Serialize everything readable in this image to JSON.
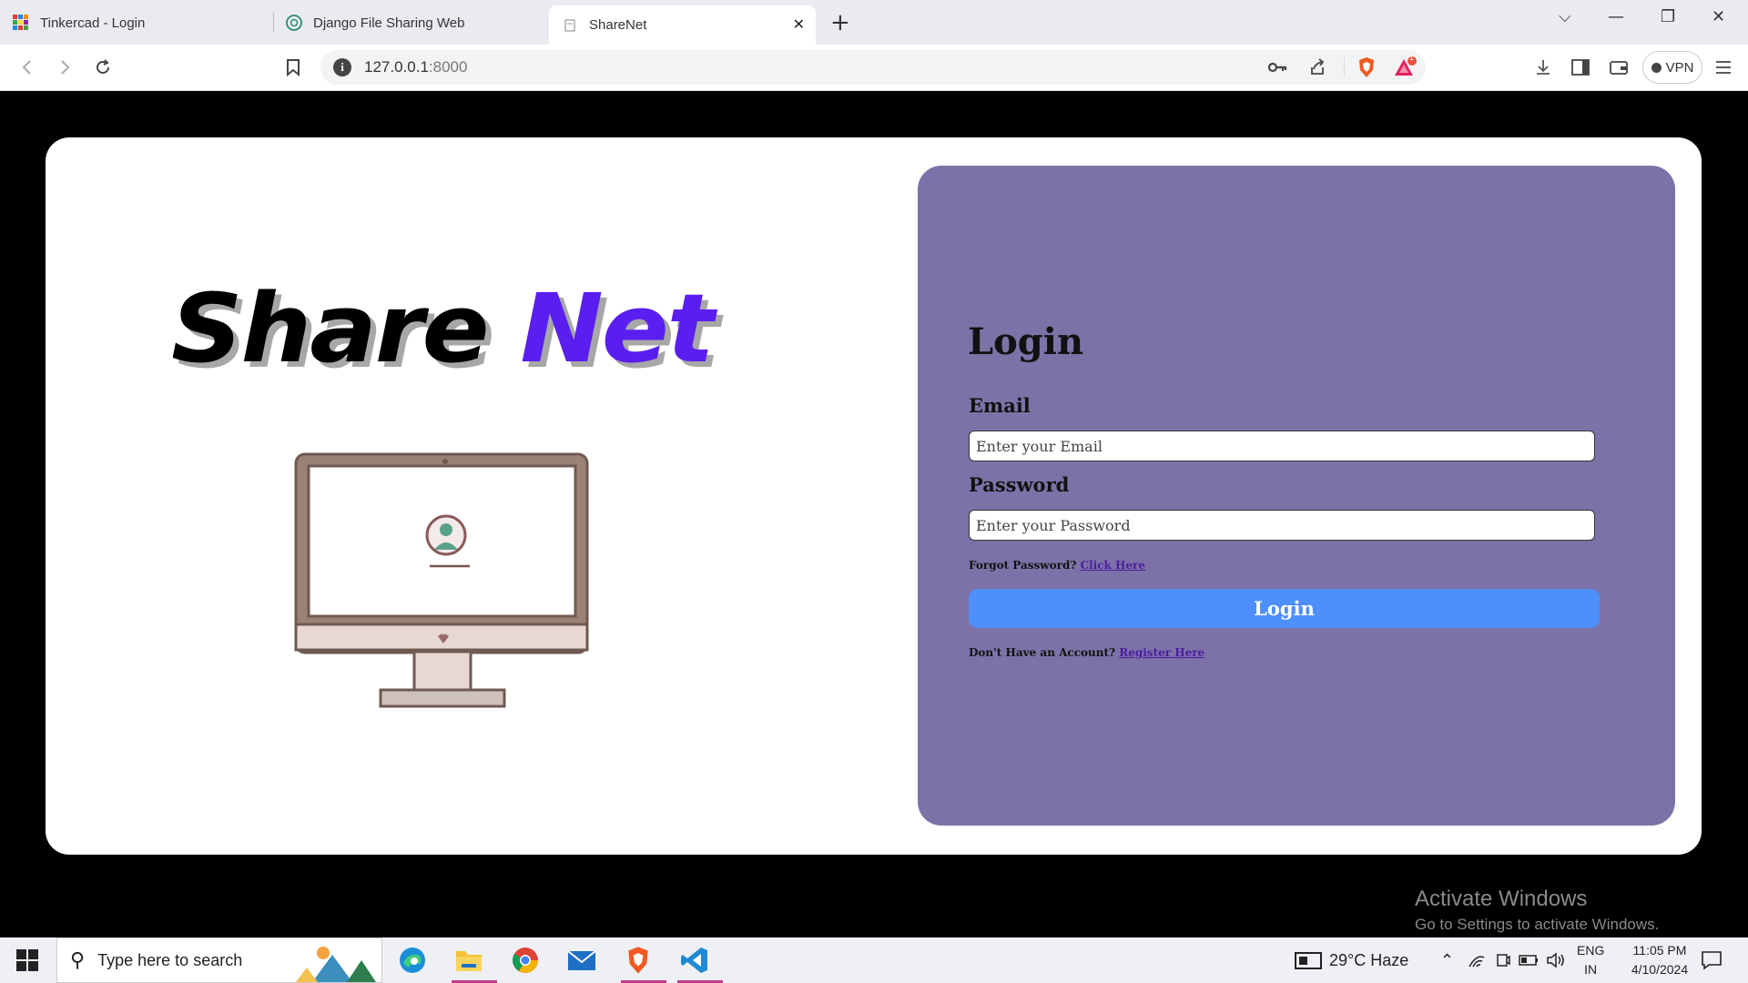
{
  "browser": {
    "tabs": [
      {
        "title": "Tinkercad - Login",
        "active": false
      },
      {
        "title": "Django File Sharing Web",
        "active": false
      },
      {
        "title": "ShareNet",
        "active": true
      }
    ],
    "url_host": "127.0.0.1",
    "url_port": ":8000",
    "vpn_label": "VPN",
    "notification_count": "1"
  },
  "page": {
    "logo_share": "Share",
    "logo_net": "Net",
    "login": {
      "title": "Login",
      "email_label": "Email",
      "email_placeholder": "Enter your Email",
      "password_label": "Password",
      "password_placeholder": "Enter your Password",
      "forgot_text": "Forgot Password?",
      "forgot_link": "Click Here",
      "login_button": "Login",
      "no_account_text": "Don't Have an Account?",
      "register_link": "Register Here"
    },
    "colors": {
      "panel": "#7d72a8",
      "button": "#4d8ffb",
      "logo_net": "#5a1ef0"
    }
  },
  "watermark": {
    "line1": "Activate Windows",
    "line2": "Go to Settings to activate Windows."
  },
  "taskbar": {
    "search_placeholder": "Type here to search",
    "weather": "29°C  Haze",
    "lang1": "ENG",
    "lang2": "IN",
    "time": "11:05 PM",
    "date": "4/10/2024"
  }
}
